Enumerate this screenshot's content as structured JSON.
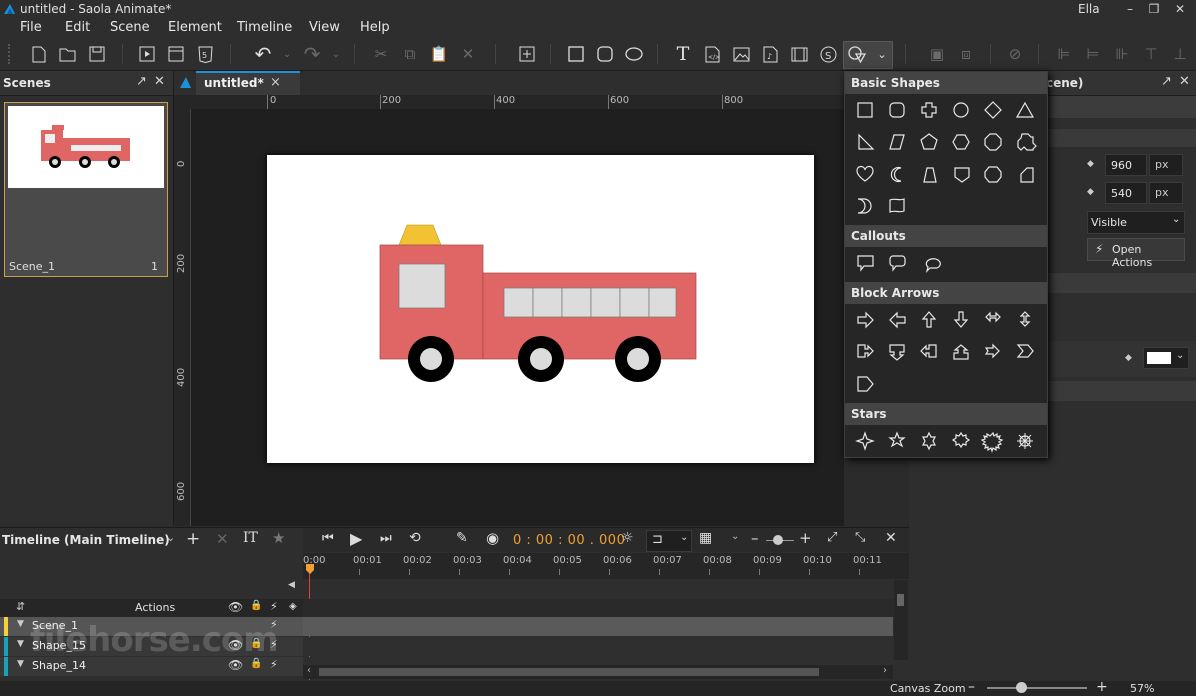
{
  "window": {
    "title": "untitled - Saola Animate*",
    "user": "Ella",
    "minimize": "–",
    "restore": "❐",
    "close": "✕"
  },
  "menu": [
    "File",
    "Edit",
    "Scene",
    "Element",
    "Timeline",
    "View",
    "Help"
  ],
  "scenes_panel": {
    "title": "Scenes",
    "scene_name": "Scene_1",
    "scene_number": "1"
  },
  "document_tab": {
    "label": "untitled*",
    "close": "×"
  },
  "ruler_h": [
    "0",
    "200",
    "400",
    "600",
    "800"
  ],
  "ruler_v": [
    "0",
    "200",
    "400",
    "600"
  ],
  "shapes_popup": {
    "sections": [
      {
        "title": "Basic Shapes",
        "count": 21
      },
      {
        "title": "Callouts",
        "count": 3
      },
      {
        "title": "Block Arrows",
        "count": 13
      },
      {
        "title": "Stars",
        "count": 6
      }
    ]
  },
  "properties_panel": {
    "title_fragment": "cene)",
    "width_value": "960",
    "height_value": "540",
    "unit": "px",
    "visibility": "Visible",
    "open_actions": "Open Actions"
  },
  "timeline": {
    "title": "Timeline (Main Timeline)",
    "time": "0 : 00 : 00 . 000",
    "ticks": [
      "0:00",
      "00:01",
      "00:02",
      "00:03",
      "00:04",
      "00:05",
      "00:06",
      "00:07",
      "00:08",
      "00:09",
      "00:10",
      "00:11"
    ],
    "actions_label": "Actions",
    "layers": [
      {
        "name": "Scene_1",
        "color": "#f4d03f"
      },
      {
        "name": "Shape_15",
        "color": "#17a2b8"
      },
      {
        "name": "Shape_14",
        "color": "#17a2b8"
      }
    ]
  },
  "status": {
    "canvas_zoom_label": "Canvas Zoom",
    "zoom_value": "57%",
    "zoom_fraction": 0.57
  },
  "watermark": "filehorse.com",
  "colors": {
    "accent": "#1e90d6",
    "truck_red": "#e06666",
    "light_yellow": "#f1c232",
    "time_orange": "#f0a030"
  }
}
